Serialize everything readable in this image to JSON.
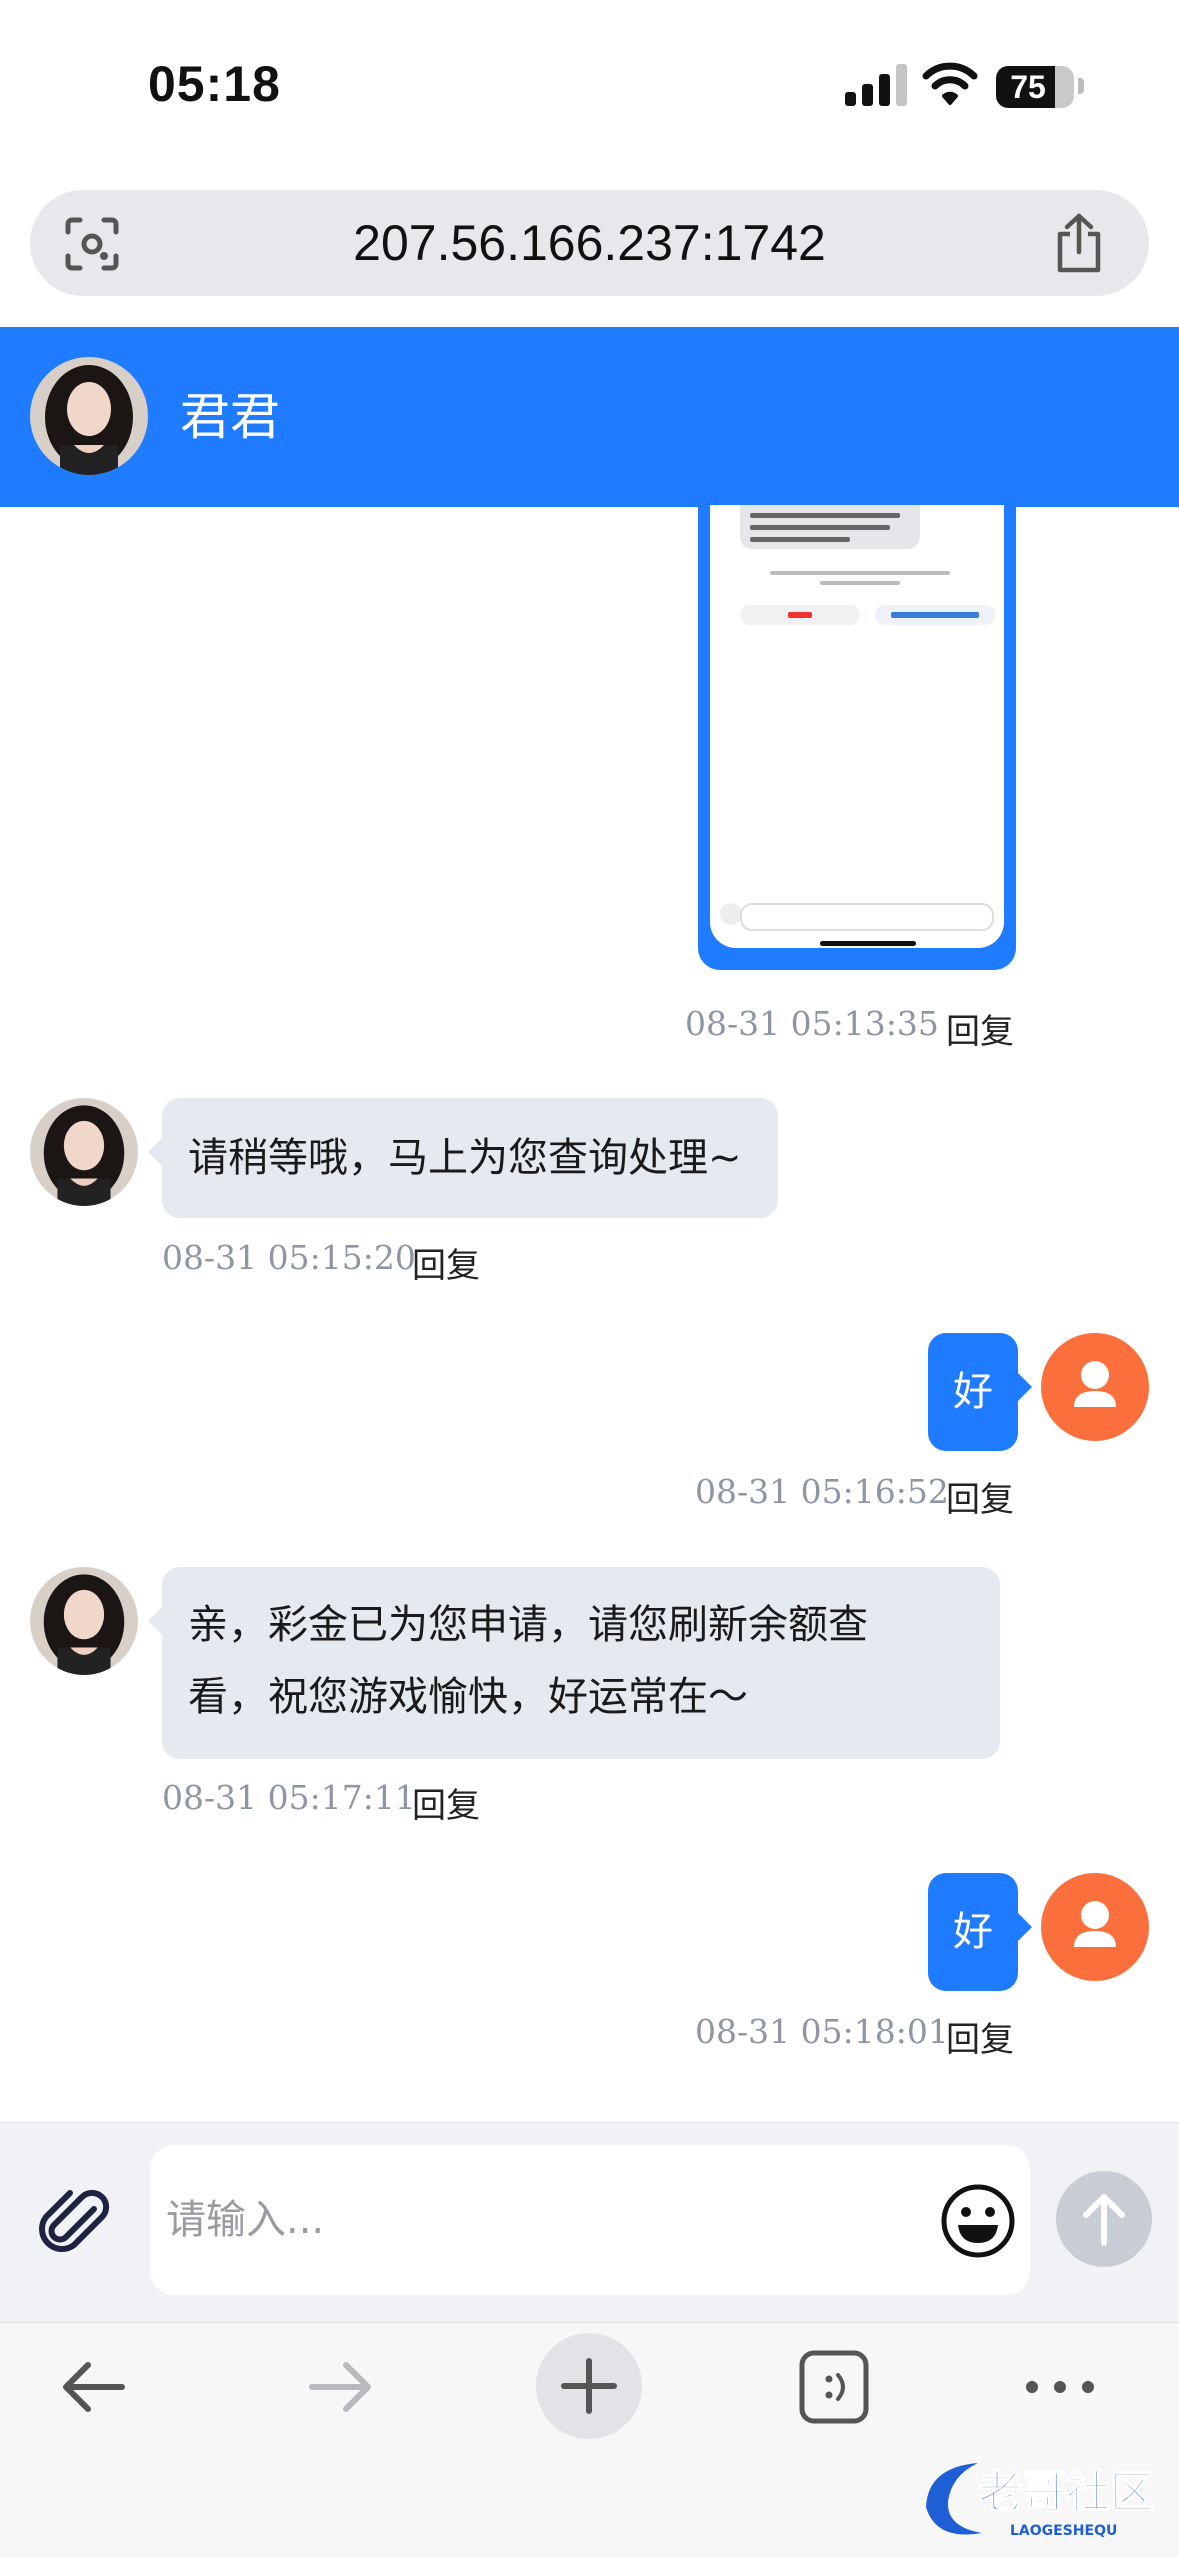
{
  "status_bar": {
    "time": "05:18",
    "battery": "75",
    "battery_level": 0.75
  },
  "browser": {
    "url": "207.56.166.237:1742"
  },
  "chat": {
    "contact_name": "君君"
  },
  "reply_label": "回复",
  "messages": [
    {
      "from": "me",
      "type": "image",
      "time": "08-31 05:13:35"
    },
    {
      "from": "agent",
      "text": "请稍等哦，马上为您查询处理~",
      "time": "08-31 05:15:20"
    },
    {
      "from": "me",
      "text": "好",
      "time": "08-31 05:16:52"
    },
    {
      "from": "agent",
      "lines": [
        "亲，彩金已为您申请，请您刷新余额查",
        "看，祝您游戏愉快，好运常在～"
      ],
      "time": "08-31 05:17:11"
    },
    {
      "from": "me",
      "text": "好",
      "time": "08-31 05:18:01"
    }
  ],
  "composer": {
    "placeholder": "请输入..."
  },
  "watermark": {
    "text": "老哥社区",
    "sub": "LAOGESHEQU"
  },
  "colors": {
    "accent": "#1f7bff",
    "me_avatar": "#fb6f3d",
    "bubble_in": "#e5e9f0"
  },
  "icons": [
    "scan-icon",
    "share-icon",
    "paperclip-icon",
    "emoji-icon",
    "send-arrow-icon",
    "back-icon",
    "forward-icon",
    "new-tab-icon",
    "tabs-icon",
    "more-icon"
  ]
}
